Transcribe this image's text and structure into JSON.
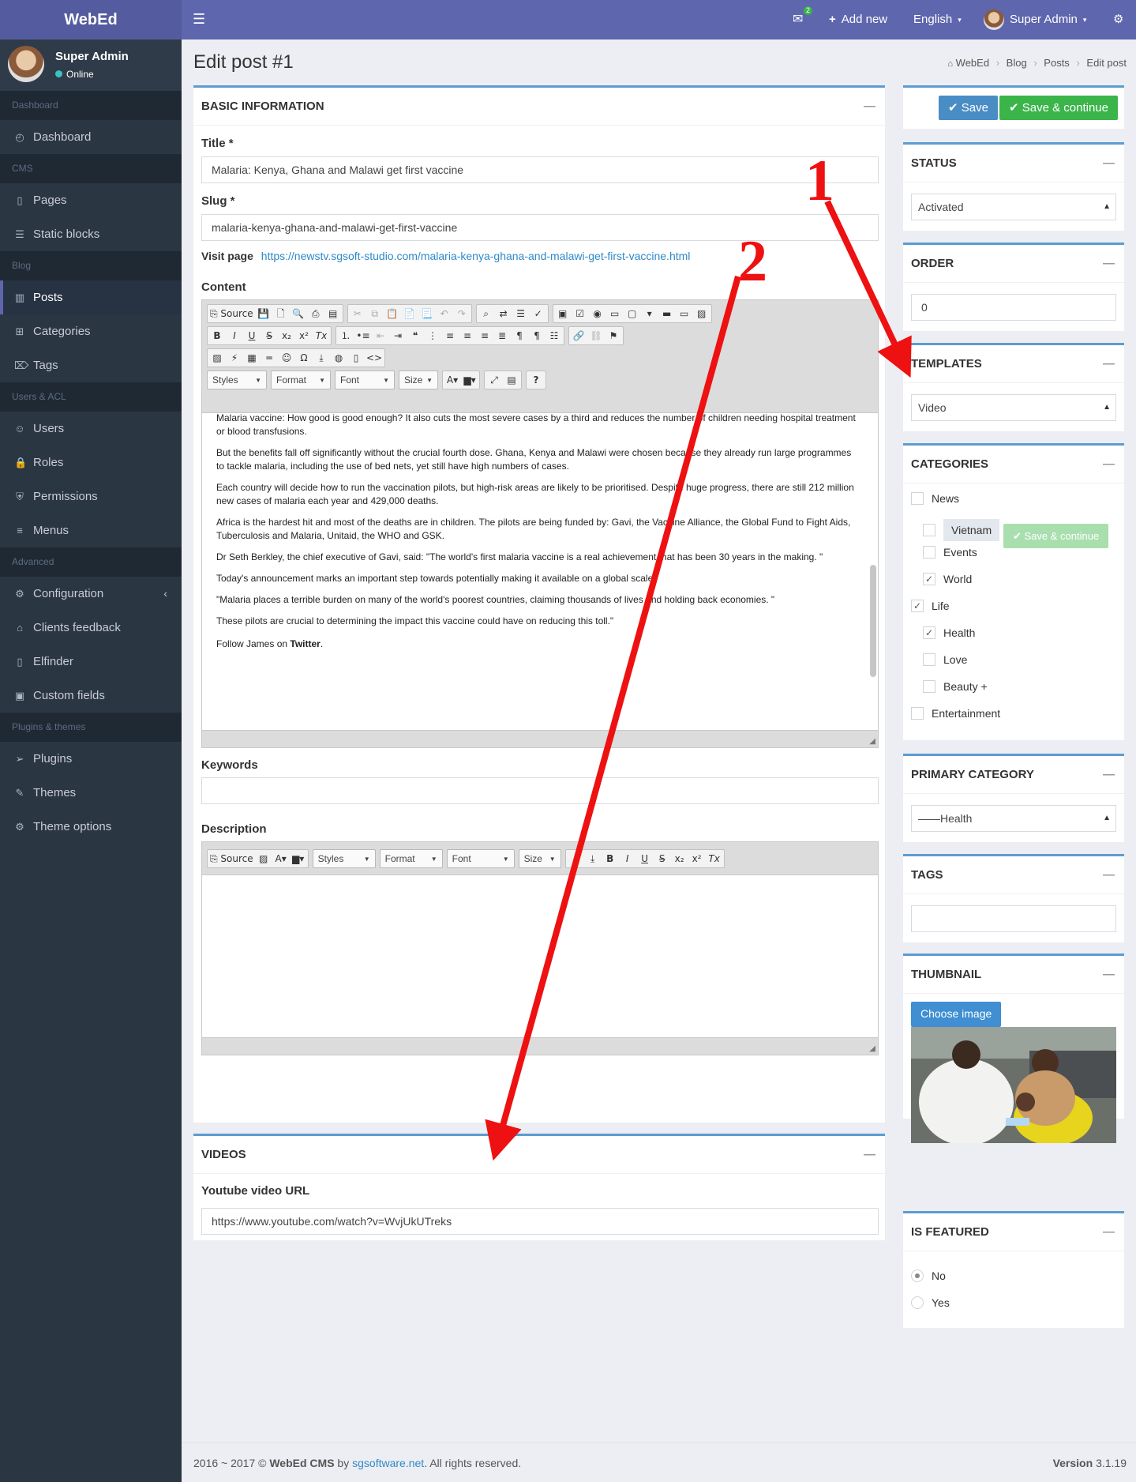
{
  "topbar": {
    "brand": "WebEd",
    "notif_count": "2",
    "add_new": "Add new",
    "language": "English",
    "user": "Super Admin"
  },
  "sidebar": {
    "user_name": "Super Admin",
    "status": "Online",
    "sections": [
      {
        "header": "Dashboard",
        "items": [
          {
            "label": "Dashboard",
            "icon": "dashboard-icon"
          }
        ]
      },
      {
        "header": "CMS",
        "items": [
          {
            "label": "Pages",
            "icon": "file-icon"
          },
          {
            "label": "Static blocks",
            "icon": "layers-icon"
          }
        ]
      },
      {
        "header": "Blog",
        "items": [
          {
            "label": "Posts",
            "icon": "book-icon",
            "active": true
          },
          {
            "label": "Categories",
            "icon": "sitemap-icon"
          },
          {
            "label": "Tags",
            "icon": "tag-icon"
          }
        ]
      },
      {
        "header": "Users & ACL",
        "items": [
          {
            "label": "Users",
            "icon": "users-icon"
          },
          {
            "label": "Roles",
            "icon": "lock-icon"
          },
          {
            "label": "Permissions",
            "icon": "shield-icon"
          },
          {
            "label": "Menus",
            "icon": "menu-icon"
          }
        ]
      },
      {
        "header": "Advanced",
        "items": [
          {
            "label": "Configuration",
            "icon": "gear-icon"
          },
          {
            "label": "Clients feedback",
            "icon": "home-icon"
          },
          {
            "label": "Elfinder",
            "icon": "file-icon"
          },
          {
            "label": "Custom fields",
            "icon": "briefcase-icon"
          }
        ]
      },
      {
        "header": "Plugins & themes",
        "items": [
          {
            "label": "Plugins",
            "icon": "paper-plane-icon"
          },
          {
            "label": "Themes",
            "icon": "brush-icon"
          },
          {
            "label": "Theme options",
            "icon": "gear-icon"
          }
        ]
      }
    ]
  },
  "page": {
    "title": "Edit post #1",
    "breadcrumb": [
      "WebEd",
      "Blog",
      "Posts",
      "Edit post"
    ]
  },
  "basic": {
    "header": "BASIC INFORMATION",
    "title_label": "Title *",
    "title_value": "Malaria: Kenya, Ghana and Malawi get first vaccine",
    "slug_label": "Slug *",
    "slug_value": "malaria-kenya-ghana-and-malawi-get-first-vaccine",
    "visit_label": "Visit page",
    "visit_url": "https://newstv.sgsoft-studio.com/malaria-kenya-ghana-and-malawi-get-first-vaccine.html",
    "content_label": "Content",
    "keywords_label": "Keywords",
    "description_label": "Description"
  },
  "editor": {
    "source": "Source",
    "styles": "Styles",
    "format": "Format",
    "font": "Font",
    "size": "Size",
    "paragraphs": [
      "Malaria vaccine: How good is good enough? It also cuts the most severe cases by a third and reduces the number of children needing hospital treatment or blood transfusions.",
      "But the benefits fall off significantly without the crucial fourth dose. Ghana, Kenya and Malawi were chosen because they already run large programmes to tackle malaria, including the use of bed nets, yet still have high numbers of cases.",
      "Each country will decide how to run the vaccination pilots, but high-risk areas are likely to be prioritised. Despite huge progress, there are still 212 million new cases of malaria each year and 429,000 deaths.",
      "Africa is the hardest hit and most of the deaths are in children. The pilots are being funded by: Gavi, the Vaccine Alliance, the Global Fund to Fight Aids, Tuberculosis and Malaria, Unitaid, the WHO and GSK.",
      "Dr Seth Berkley, the chief executive of Gavi, said: \"The world's first malaria vaccine is a real achievement that has been 30 years in the making. \"",
      "Today's announcement marks an important step towards potentially making it available on a global scale.",
      "\"Malaria places a terrible burden on many of the world's poorest countries, claiming thousands of lives and holding back economies. \"",
      "These pilots are crucial to determining the impact this vaccine could have on reducing this toll.\""
    ],
    "follow_prefix": "Follow James on ",
    "follow_bold": "Twitter",
    "follow_suffix": "."
  },
  "videos": {
    "header": "VIDEOS",
    "label": "Youtube video URL",
    "value": "https://www.youtube.com/watch?v=WvjUkUTreks"
  },
  "actions": {
    "save": "Save",
    "save_continue": "Save & continue",
    "floating_save_continue": "Save & continue"
  },
  "status": {
    "header": "STATUS",
    "value": "Activated"
  },
  "order": {
    "header": "ORDER",
    "value": "0"
  },
  "templates": {
    "header": "TEMPLATES",
    "value": "Video"
  },
  "categories": {
    "header": "CATEGORIES",
    "items": [
      {
        "label": "News",
        "level": 0,
        "checked": false
      },
      {
        "label": "Vietnam",
        "level": 1,
        "checked": false
      },
      {
        "label": "Events",
        "level": 1,
        "checked": false
      },
      {
        "label": "World",
        "level": 1,
        "checked": true
      },
      {
        "label": "Life",
        "level": 0,
        "checked": true
      },
      {
        "label": "Health",
        "level": 1,
        "checked": true
      },
      {
        "label": "Love",
        "level": 1,
        "checked": false
      },
      {
        "label": "Beauty +",
        "level": 1,
        "checked": false
      },
      {
        "label": "Entertainment",
        "level": 0,
        "checked": false
      }
    ]
  },
  "primary_category": {
    "header": "PRIMARY CATEGORY",
    "value": "——Health"
  },
  "tags": {
    "header": "TAGS",
    "value": ""
  },
  "thumbnail": {
    "header": "THUMBNAIL",
    "button": "Choose image"
  },
  "featured": {
    "header": "IS FEATURED",
    "options": [
      {
        "label": "No",
        "selected": true
      },
      {
        "label": "Yes",
        "selected": false
      }
    ]
  },
  "annotations": {
    "one": "1",
    "two": "2",
    "color": "#ee1111"
  },
  "footer": {
    "copy_prefix": "2016 ~ 2017 © ",
    "brand": "WebEd CMS",
    "by": " by ",
    "link": "sgsoftware.net",
    "suffix": ". All rights reserved.",
    "version_label": "Version",
    "version": "3.1.19"
  }
}
